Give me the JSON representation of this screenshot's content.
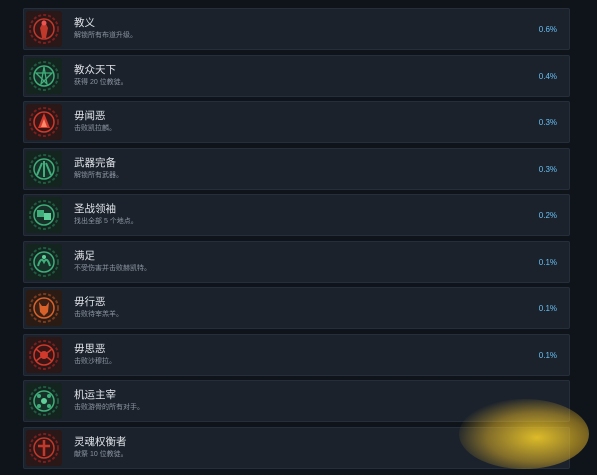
{
  "achievements": [
    {
      "title": "教义",
      "desc": "解锁所有布道升级。",
      "pct": "0.6%",
      "icon": "red-cult-figure-icon",
      "color": "#c0392b",
      "ring": "#7a1e1e"
    },
    {
      "title": "教众天下",
      "desc": "获得 20 位教徒。",
      "pct": "0.4%",
      "icon": "green-pentagram-icon",
      "color": "#3fae7a",
      "ring": "#1f5a42"
    },
    {
      "title": "毋闻恶",
      "desc": "击败凯拉麟。",
      "pct": "0.3%",
      "icon": "red-flame-heart-icon",
      "color": "#d0392b",
      "ring": "#7a1e1e"
    },
    {
      "title": "武器完备",
      "desc": "解锁所有武器。",
      "pct": "0.3%",
      "icon": "green-weapons-icon",
      "color": "#3fae7a",
      "ring": "#1f5a42"
    },
    {
      "title": "圣战领袖",
      "desc": "找出全部 5 个地点。",
      "pct": "0.2%",
      "icon": "green-dice-icon",
      "color": "#3fae7a",
      "ring": "#1f5a42"
    },
    {
      "title": "满足",
      "desc": "不受伤害并击败赫凯特。",
      "pct": "0.1%",
      "icon": "green-hands-icon",
      "color": "#3fae7a",
      "ring": "#1f5a42"
    },
    {
      "title": "毋行恶",
      "desc": "击败待宰羔羊。",
      "pct": "0.1%",
      "icon": "orange-beast-icon",
      "color": "#d9622b",
      "ring": "#7a3a1e"
    },
    {
      "title": "毋思恶",
      "desc": "击败沙穆拉。",
      "pct": "0.1%",
      "icon": "red-spider-icon",
      "color": "#d0392b",
      "ring": "#7a1e1e"
    },
    {
      "title": "机运主宰",
      "desc": "击败游骨的所有对手。",
      "pct": "",
      "icon": "green-dice-wheel-icon",
      "color": "#3fae7a",
      "ring": "#1f5a42"
    },
    {
      "title": "灵魂权衡者",
      "desc": "献祭 10 位教徒。",
      "pct": "",
      "icon": "red-skull-icon",
      "color": "#c0392b",
      "ring": "#7a1e1e"
    }
  ]
}
